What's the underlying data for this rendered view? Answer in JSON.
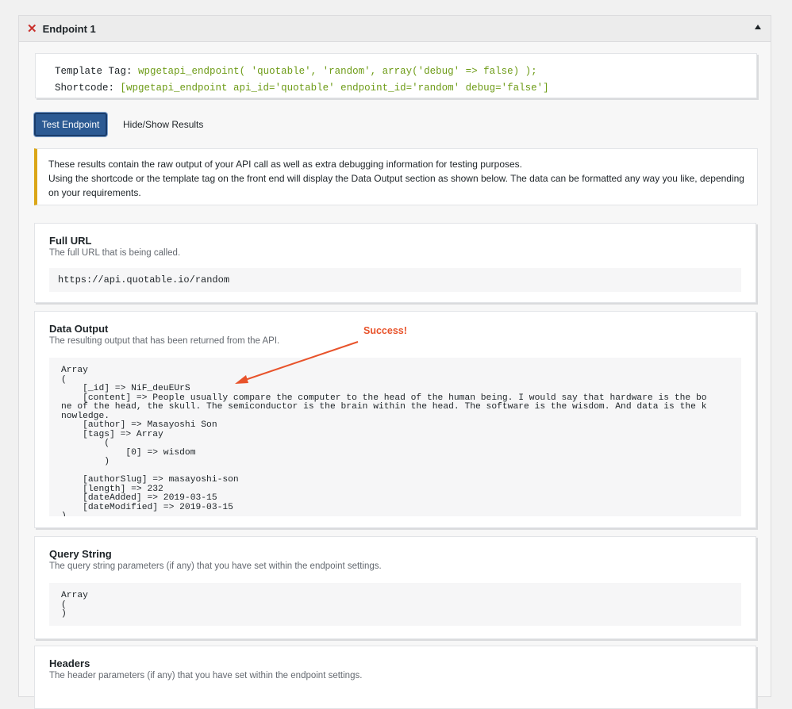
{
  "panel": {
    "title": "Endpoint 1",
    "close_icon": "close-x-icon",
    "toggle_icon": "triangle-up-icon"
  },
  "tags": {
    "template_label": "Template Tag:",
    "template_code": "wpgetapi_endpoint( 'quotable', 'random', array('debug' => false) );",
    "shortcode_label": "Shortcode:",
    "shortcode_code": "[wpgetapi_endpoint api_id='quotable' endpoint_id='random' debug='false']"
  },
  "buttons": {
    "test": "Test Endpoint",
    "toggle_results": "Hide/Show Results"
  },
  "notice": {
    "line1": "These results contain the raw output of your API call as well as extra debugging information for testing purposes.",
    "line2": "Using the shortcode or the template tag on the front end will display the Data Output section as shown below. The data can be formatted any way you like, depending on your requirements."
  },
  "full_url": {
    "title": "Full URL",
    "description": "The full URL that is being called.",
    "value": "https://api.quotable.io/random"
  },
  "data_output": {
    "title": "Data Output",
    "description": "The resulting output that has been returned from the API.",
    "annotation": "Success!",
    "value": "Array\n(\n    [_id] => NiF_deuEUrS\n    [content] => People usually compare the computer to the head of the human being. I would say that hardware is the bo\nne of the head, the skull. The semiconductor is the brain within the head. The software is the wisdom. And data is the k\nnowledge.\n    [author] => Masayoshi Son\n    [tags] => Array\n        (\n            [0] => wisdom\n        )\n\n    [authorSlug] => masayoshi-son\n    [length] => 232\n    [dateAdded] => 2019-03-15\n    [dateModified] => 2019-03-15\n)"
  },
  "query_string": {
    "title": "Query String",
    "description": "The query string parameters (if any) that you have set within the endpoint settings.",
    "value": "Array\n(\n)"
  },
  "headers": {
    "title": "Headers",
    "description": "The header parameters (if any) that you have set within the endpoint settings."
  },
  "colors": {
    "accent": "#2c5a93",
    "code": "#6d9b16",
    "notice_border": "#dba617",
    "annotation": "#e8532b",
    "close": "#c9302c"
  }
}
